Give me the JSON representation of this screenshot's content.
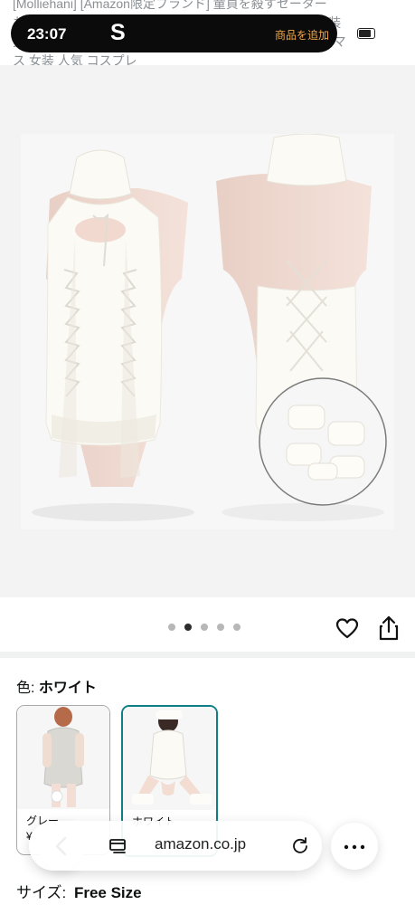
{
  "header": {
    "title_line1": "[Molliehani] [Amazon限定ブランド] 童貞を殺すセーター",
    "title_line2": "お得な3点セット 背中 バックレス 可愛い プレゼント 衣装",
    "title_line3": "女性 コスチューム セクシー ランジェリー ニット クリスマ",
    "title_line4": "ス 女装 人気 コスプレ"
  },
  "status_bar": {
    "time": "23:07",
    "app_logo": "S",
    "add_product": "商品を追加"
  },
  "gallery": {
    "dots_count": 5,
    "active_dot_index": 1,
    "favorite_icon": "heart-icon",
    "share_icon": "share-icon"
  },
  "variation": {
    "color_label": "色:",
    "color_value": "ホワイト",
    "swatches": [
      {
        "name": "グレー",
        "price": "¥"
      },
      {
        "name": "ホワイト",
        "price": ""
      }
    ]
  },
  "browser": {
    "url": "amazon.co.jp",
    "back_icon": "chevron-left-icon",
    "tabs_icon": "tabs-icon",
    "reload_icon": "reload-icon",
    "more_icon": "more-icon"
  },
  "size": {
    "label": "サイズ:",
    "value": "Free Size"
  },
  "colors": {
    "status_pill": "#0b0b0b",
    "accent_orange": "#f3a847",
    "selected_border": "#0f7f86",
    "active_dot": "#2d2d2d"
  }
}
